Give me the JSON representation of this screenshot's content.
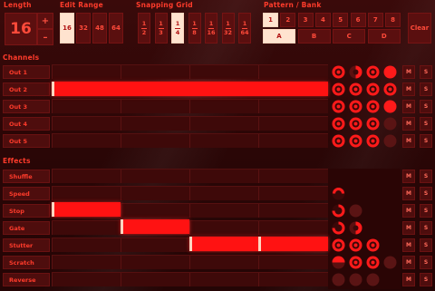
{
  "sections": {
    "length": "Length",
    "edit_range": "Edit Range",
    "snapping_grid": "Snapping Grid",
    "pattern_bank": "Pattern / Bank",
    "channels": "Channels",
    "effects": "Effects"
  },
  "length": {
    "value": "16",
    "plus": "+",
    "minus": "–"
  },
  "edit_range": [
    {
      "label": "16",
      "selected": true
    },
    {
      "label": "32",
      "selected": false
    },
    {
      "label": "48",
      "selected": false
    },
    {
      "label": "64",
      "selected": false
    }
  ],
  "snapping_grid": [
    {
      "num": "1",
      "den": "2",
      "selected": false
    },
    {
      "num": "1",
      "den": "3",
      "selected": false
    },
    {
      "num": "1",
      "den": "4",
      "selected": true
    },
    {
      "num": "1",
      "den": "8",
      "selected": false
    },
    {
      "num": "1",
      "den": "16",
      "selected": false
    },
    {
      "num": "1",
      "den": "32",
      "selected": false
    },
    {
      "num": "1",
      "den": "64",
      "selected": false
    }
  ],
  "patterns": [
    "1",
    "2",
    "3",
    "4",
    "5",
    "6",
    "7",
    "8"
  ],
  "selected_pattern": "1",
  "banks": [
    "A",
    "B",
    "C",
    "D"
  ],
  "selected_bank": "A",
  "clear_label": "Clear",
  "channels": [
    {
      "label": "Out 1"
    },
    {
      "label": "Out 2"
    },
    {
      "label": "Out 3"
    },
    {
      "label": "Out 4"
    },
    {
      "label": "Out 5"
    }
  ],
  "effects": [
    {
      "label": "Shuffle"
    },
    {
      "label": "Speed"
    },
    {
      "label": "Stop"
    },
    {
      "label": "Gate"
    },
    {
      "label": "Stutter"
    },
    {
      "label": "Scratch"
    },
    {
      "label": "Reverse"
    }
  ],
  "mute_label": "M",
  "solo_label": "S",
  "colors": {
    "accent": "#ff1212",
    "label": "#ff3b2b",
    "selected": "#ffe3cf"
  }
}
